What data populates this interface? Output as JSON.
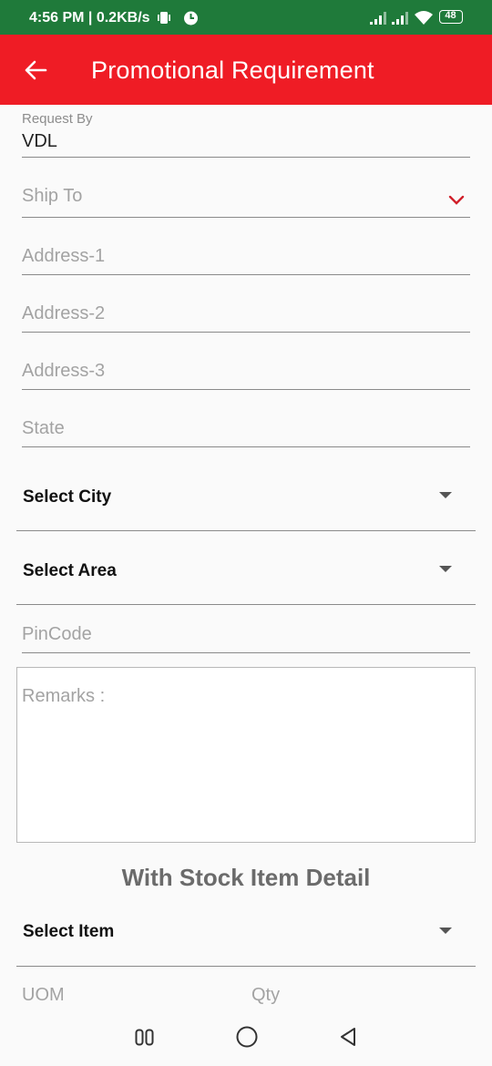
{
  "status_bar": {
    "time": "4:56 PM | 0.2KB/s",
    "battery": "48",
    "icons": [
      "vibrate-icon",
      "app-notification-icon",
      "signal-icon",
      "signal-icon",
      "wifi-icon",
      "battery-icon"
    ]
  },
  "app_bar": {
    "title": "Promotional  Requirement",
    "back_icon": "arrow-left-icon",
    "color": "#ef1c25"
  },
  "form": {
    "request_by": {
      "label": "Request By",
      "value": "VDL"
    },
    "ship_to": {
      "placeholder": "Ship To"
    },
    "address_1": {
      "placeholder": "Address-1"
    },
    "address_2": {
      "placeholder": "Address-2"
    },
    "address_3": {
      "placeholder": "Address-3"
    },
    "state": {
      "placeholder": "State"
    },
    "city": {
      "label": "Select City"
    },
    "area": {
      "label": "Select Area"
    },
    "pincode": {
      "placeholder": "PinCode"
    },
    "remarks": {
      "placeholder": "Remarks :"
    }
  },
  "stock_section": {
    "title": "With Stock Item Detail",
    "item_select": {
      "label": "Select Item"
    },
    "columns": [
      "UOM",
      "Qty"
    ]
  },
  "nav_bar": {
    "icons": [
      "recent-apps-icon",
      "home-icon",
      "back-icon"
    ]
  }
}
